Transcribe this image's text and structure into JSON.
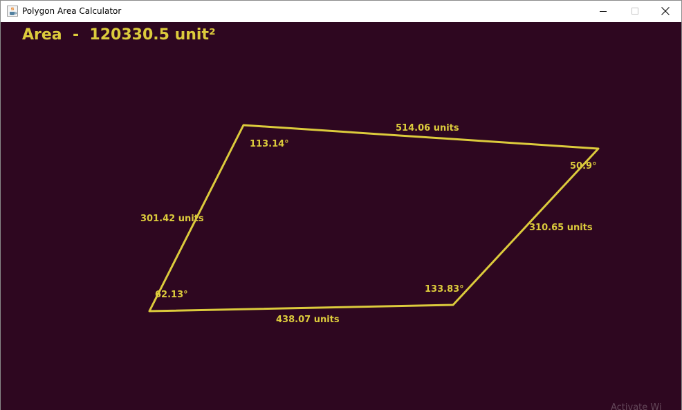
{
  "window": {
    "title": "Polygon Area Calculator",
    "app_icon": "java-cup-icon",
    "controls": {
      "minimize_icon": "minimize-icon",
      "maximize_icon": "maximize-icon",
      "close_icon": "close-icon"
    }
  },
  "canvas": {
    "background_color": "#2e0720",
    "accent_color": "#dccb3c",
    "area_text": "Area  -  120330.5 unit²",
    "side_labels": [
      "514.06 units",
      "301.42 units",
      "310.65 units",
      "438.07 units"
    ],
    "angle_labels": [
      "113.14°",
      "50.9°",
      "62.13°",
      "133.83°"
    ],
    "footer_fade": "Activate Wi"
  }
}
